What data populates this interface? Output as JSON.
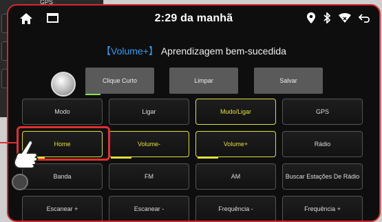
{
  "background": {
    "tab_label": "GPS"
  },
  "status_bar": {
    "time": "2:29 da manhã",
    "icons": [
      "home-icon",
      "window-icon",
      "location-icon",
      "bluetooth-icon",
      "wifi-icon",
      "back-icon"
    ]
  },
  "message": {
    "highlight": "【Volume+】",
    "text": "Aprendizagem bem-sucedida"
  },
  "controls": {
    "short_press": "Clique Curto",
    "clear": "Limpar",
    "save": "Salvar"
  },
  "grid": [
    {
      "label": "Modo",
      "active": false
    },
    {
      "label": "Ligar",
      "active": false
    },
    {
      "label": "Mudo/Ligar",
      "active": true
    },
    {
      "label": "GPS",
      "active": false
    },
    {
      "label": "Home",
      "active": true
    },
    {
      "label": "Volume-",
      "active": true
    },
    {
      "label": "Volume+",
      "active": true
    },
    {
      "label": "Rádio",
      "active": false
    },
    {
      "label": "Banda",
      "active": false
    },
    {
      "label": "FM",
      "active": false
    },
    {
      "label": "AM",
      "active": false
    },
    {
      "label": "Buscar Estações De Rádio",
      "active": false
    },
    {
      "label": "Escanear +",
      "active": false
    },
    {
      "label": "Escanear -",
      "active": false
    },
    {
      "label": "Frequência -",
      "active": false
    },
    {
      "label": "Frequência +",
      "active": false
    }
  ],
  "colors": {
    "accent_yellow": "#e3e03b",
    "highlight_blue": "#2e9cf0",
    "frame_red": "#d42a2a"
  }
}
